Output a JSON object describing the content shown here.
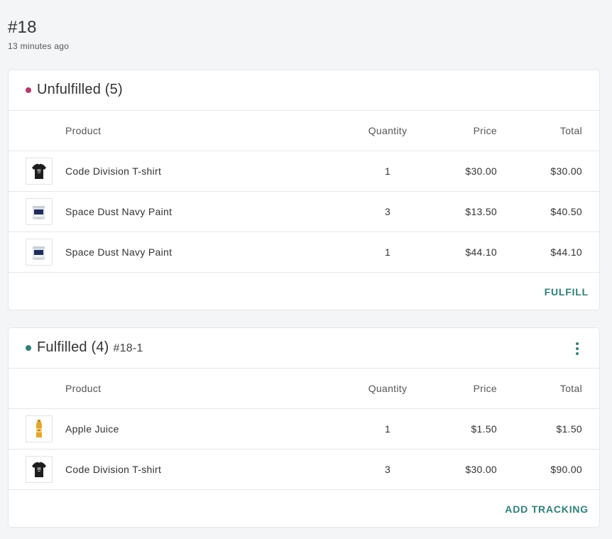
{
  "order": {
    "number": "#18",
    "time": "13 minutes ago"
  },
  "columns": {
    "product": "Product",
    "quantity": "Quantity",
    "price": "Price",
    "total": "Total"
  },
  "unfulfilled": {
    "title": "Unfulfilled (5)",
    "dot_color": "#b23a6b",
    "action_label": "FULFILL",
    "items": [
      {
        "image": "tshirt-image",
        "name": "Code Division T-shirt",
        "quantity": "1",
        "price": "$30.00",
        "total": "$30.00"
      },
      {
        "image": "paint-can-image",
        "name": "Space Dust Navy Paint",
        "quantity": "3",
        "price": "$13.50",
        "total": "$40.50"
      },
      {
        "image": "paint-can-image",
        "name": "Space Dust Navy Paint",
        "quantity": "1",
        "price": "$44.10",
        "total": "$44.10"
      }
    ]
  },
  "fulfilled": {
    "title": "Fulfilled (4)",
    "fulfillment_id": "#18-1",
    "dot_color": "#2f7f7a",
    "menu_icon": "more-vertical-icon",
    "action_label": "ADD TRACKING",
    "items": [
      {
        "image": "juice-bottle-image",
        "name": "Apple Juice",
        "quantity": "1",
        "price": "$1.50",
        "total": "$1.50"
      },
      {
        "image": "tshirt-image",
        "name": "Code Division T-shirt",
        "quantity": "3",
        "price": "$30.00",
        "total": "$90.00"
      }
    ]
  },
  "colors": {
    "accent": "#2f7f7a",
    "unfulfilled": "#b23a6b",
    "background": "#f3f5f6"
  }
}
